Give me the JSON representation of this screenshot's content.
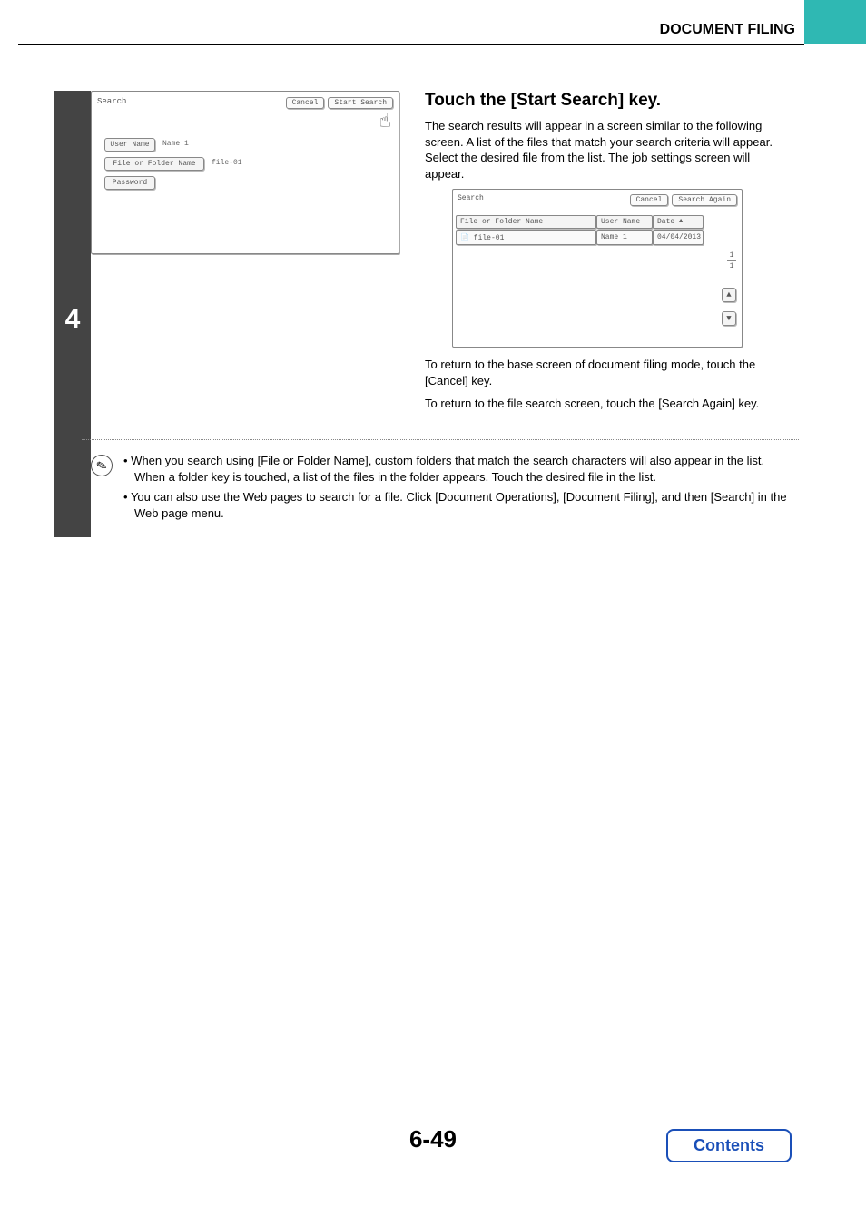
{
  "header": {
    "title": "DOCUMENT FILING"
  },
  "step_number": "4",
  "left_panel": {
    "title": "Search",
    "cancel": "Cancel",
    "start_search": "Start Search",
    "fields": {
      "user_name_label": "User Name",
      "user_name_value": "Name 1",
      "file_folder_label": "File or Folder Name",
      "file_folder_value": "file-01",
      "password_label": "Password"
    }
  },
  "right": {
    "title": "Touch the [Start Search] key.",
    "para1": "The search results will appear in a screen similar to the following screen. A list of the files that match your search criteria will appear. Select the desired file from the list. The job settings screen will appear.",
    "para2": "To return to the base screen of document filing mode, touch the [Cancel] key.",
    "para3": "To return to the file search screen, touch the [Search Again] key."
  },
  "results_panel": {
    "title": "Search",
    "cancel": "Cancel",
    "search_again": "Search Again",
    "col_file": "File or Folder Name",
    "col_user": "User Name",
    "col_date": "Date",
    "row_file": "file-01",
    "row_user": "Name 1",
    "row_date": "04/04/2013",
    "page_top": "1",
    "page_bottom": "1"
  },
  "notes": {
    "bullet1": "When you search using [File or Folder Name], custom folders that match the search characters will also appear in the list. When a folder key is touched, a list of the files in the folder appears. Touch the desired file in the list.",
    "bullet2": "You can also use the Web pages to search for a file. Click [Document Operations], [Document Filing], and then [Search] in the Web page menu."
  },
  "footer": {
    "page": "6-49",
    "contents": "Contents"
  }
}
